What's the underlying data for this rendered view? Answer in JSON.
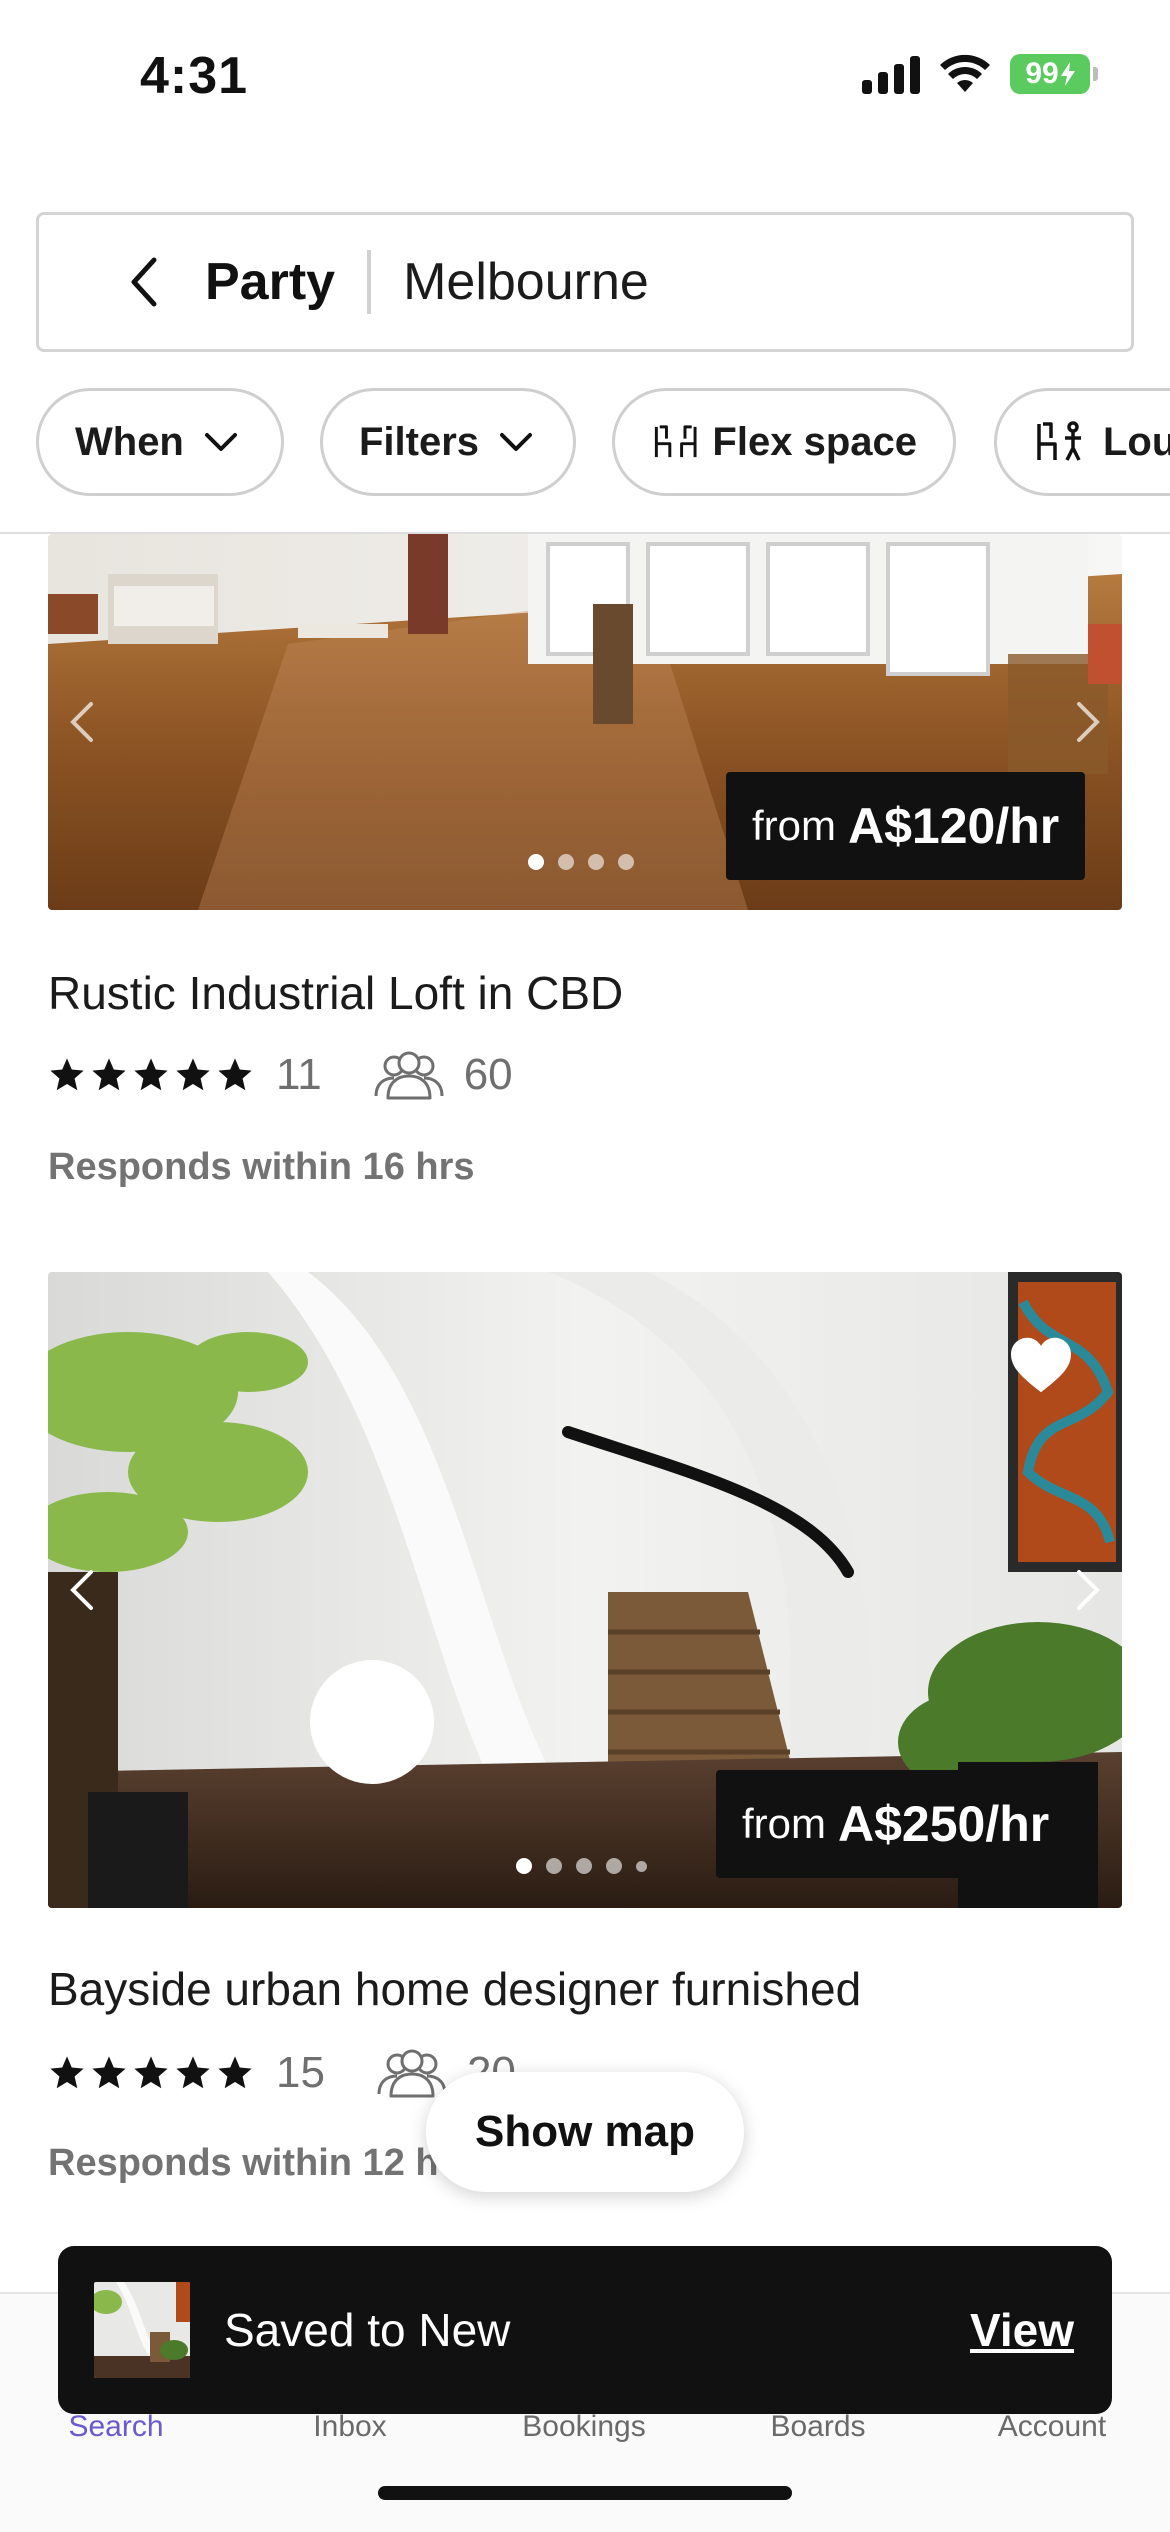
{
  "status_bar": {
    "time": "4:31",
    "battery": "99"
  },
  "search": {
    "activity": "Party",
    "location": "Melbourne",
    "back_icon": "chevron-left-icon"
  },
  "filters": [
    {
      "label": "When",
      "icon": "chevron-down-icon"
    },
    {
      "label": "Filters",
      "icon": "chevron-down-icon"
    },
    {
      "label": "Flex space",
      "icon": "chairs-icon"
    },
    {
      "label": "Lou",
      "icon": "lounge-icon"
    }
  ],
  "listings": [
    {
      "title": "Rustic Industrial Loft in CBD",
      "price_prefix": "from",
      "price": "A$120/hr",
      "rating_count": "11",
      "guests": "60",
      "responds": "Responds within 16 hrs",
      "photo_index": 1,
      "photo_count": 4
    },
    {
      "title": "Bayside urban home designer furnished",
      "price_prefix": "from",
      "price": "A$250/hr",
      "rating_count": "15",
      "guests": "20",
      "responds": "Responds within 12 h",
      "photo_index": 1,
      "photo_count": 5,
      "saved": true
    }
  ],
  "show_map": "Show map",
  "toast": {
    "message": "Saved to New",
    "action": "View"
  },
  "bottom_nav": [
    {
      "label": "Search",
      "active": true
    },
    {
      "label": "Inbox",
      "active": false
    },
    {
      "label": "Bookings",
      "active": false
    },
    {
      "label": "Boards",
      "active": false
    },
    {
      "label": "Account",
      "active": false
    }
  ],
  "colors": {
    "accent": "#6a5acd",
    "toast_bg": "#111111",
    "battery": "#5ccb5f"
  }
}
